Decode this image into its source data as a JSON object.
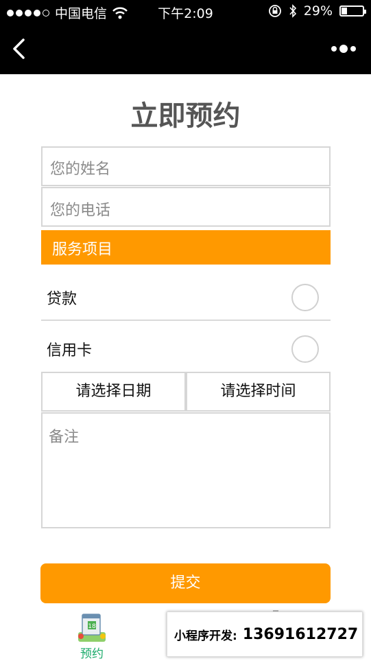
{
  "status_bar": {
    "carrier": "中国电信",
    "time": "下午2:09",
    "battery_percent": "29%",
    "battery_level": 0.29
  },
  "nav": {
    "back_icon": "chevron-left-icon",
    "more_icon": "more-dots-icon"
  },
  "page": {
    "title": "立即预约"
  },
  "form": {
    "name_placeholder": "您的姓名",
    "phone_placeholder": "您的电话",
    "service_header": "服务项目",
    "services": [
      {
        "label": "贷款",
        "selected": false
      },
      {
        "label": "信用卡",
        "selected": false
      }
    ],
    "date_picker": "请选择日期",
    "time_picker": "请选择时间",
    "remark_placeholder": "备注",
    "submit_label": "提交"
  },
  "tab_bar": {
    "tabs": [
      {
        "label": "预约",
        "icon": "calendar-icon",
        "active": true
      }
    ]
  },
  "banner": {
    "label": "小程序开发:",
    "phone": "13691612727"
  },
  "colors": {
    "accent": "#ff9900",
    "tab_active": "#1aaa6a",
    "border": "#d6d6d6"
  }
}
